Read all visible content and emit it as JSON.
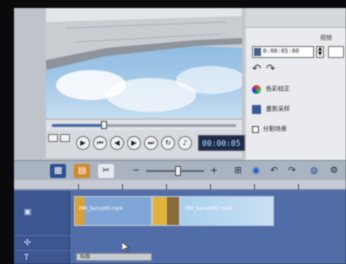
{
  "transport": {
    "timecode": "00:00:05",
    "buttons": [
      "play",
      "start",
      "prev-frame",
      "next-frame",
      "end",
      "repeat",
      "volume"
    ],
    "scrub_progress": 0.28
  },
  "options": {
    "tabs": [
      "",
      "",
      "视频"
    ],
    "duration_value": "0:00:05:00",
    "rows": [
      {
        "label": "色彩校正",
        "icon": "color-correction-icon"
      },
      {
        "label": "重新采样",
        "icon": "resample-icon"
      },
      {
        "label": "分割场景",
        "icon": "split-scene-icon"
      }
    ]
  },
  "toolbar": {
    "tools": [
      "storyboard-view-icon",
      "timeline-view-icon",
      "audio-view-icon",
      "zoom-out-icon",
      "zoom-in-icon",
      "fit-icon",
      "record-icon",
      "undo-icon",
      "redo-icon",
      "smart-proxy-icon",
      "track-manager-icon"
    ],
    "zoom_level": 0.55
  },
  "timeline": {
    "clips": [
      {
        "name": "HM_Sunset0.mp4"
      },
      {
        "name": ""
      },
      {
        "name": "HM_Sunset02.mp4"
      }
    ],
    "title_clip": "标题"
  },
  "colors": {
    "timeline_bg": "#516da8",
    "timecode_bg": "#1d2a4a",
    "sky": "#8fbce2"
  }
}
